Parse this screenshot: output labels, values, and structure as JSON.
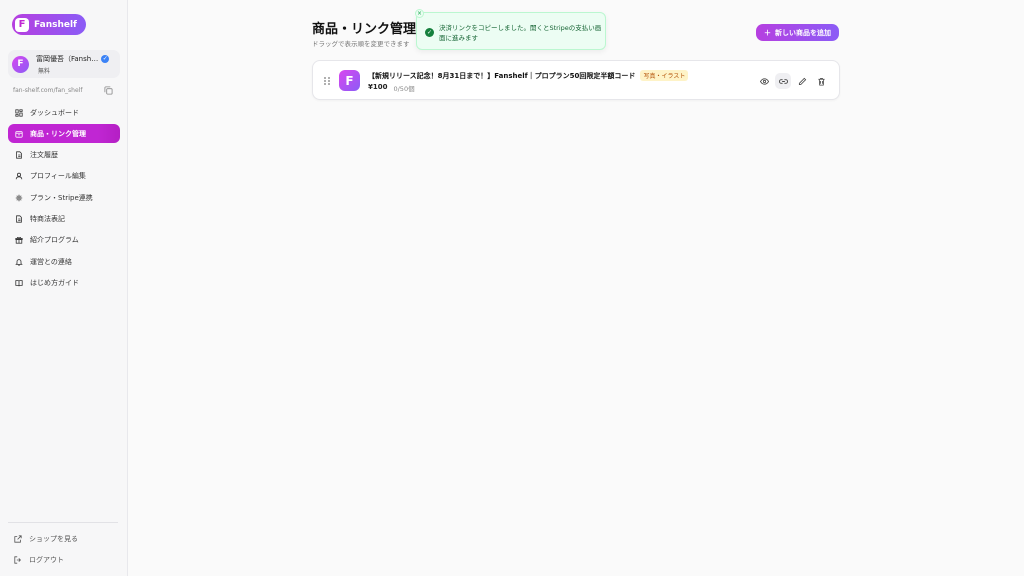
{
  "app": {
    "brand": "Fanshelf",
    "brand_mark": "F"
  },
  "user": {
    "name": "富岡優吾（Fansh…",
    "plan": "無料",
    "avatar_letter": "F"
  },
  "shop_url": "fan-shelf.com/fan_shelf",
  "nav": [
    {
      "label": "ダッシュボード",
      "icon": "dashboard-icon"
    },
    {
      "label": "商品・リンク管理",
      "icon": "box-icon",
      "active": true
    },
    {
      "label": "注文履歴",
      "icon": "document-icon"
    },
    {
      "label": "プロフィール編集",
      "icon": "user-icon"
    },
    {
      "label": "プラン・Stripe連携",
      "icon": "gear-icon"
    },
    {
      "label": "特商法表記",
      "icon": "document-icon"
    },
    {
      "label": "紹介プログラム",
      "icon": "gift-icon"
    },
    {
      "label": "運営との連絡",
      "icon": "bell-icon"
    },
    {
      "label": "はじめ方ガイド",
      "icon": "book-icon"
    }
  ],
  "footer": {
    "view_shop": "ショップを見る",
    "logout": "ログアウト"
  },
  "page": {
    "title": "商品・リンク管理",
    "subtitle": "ドラッグで表示順を変更できます",
    "add_button": "新しい商品を追加"
  },
  "toast": {
    "message": "決済リンクをコピーしました。開くとStripeの支払い画面に進みます",
    "close": "×",
    "check": "✓"
  },
  "product": {
    "title": "【新規リリース記念！8月31日まで！】Fanshelf｜プロプラン50回限定半額コード",
    "tag": "写真・イラスト",
    "price": "¥100",
    "stock": "0/50個",
    "icon_letter": "F"
  },
  "colors": {
    "accent": "#c026d3",
    "accent2": "#8b5cf6",
    "toast_bg": "#ecfdf3",
    "toast_text": "#166534"
  }
}
